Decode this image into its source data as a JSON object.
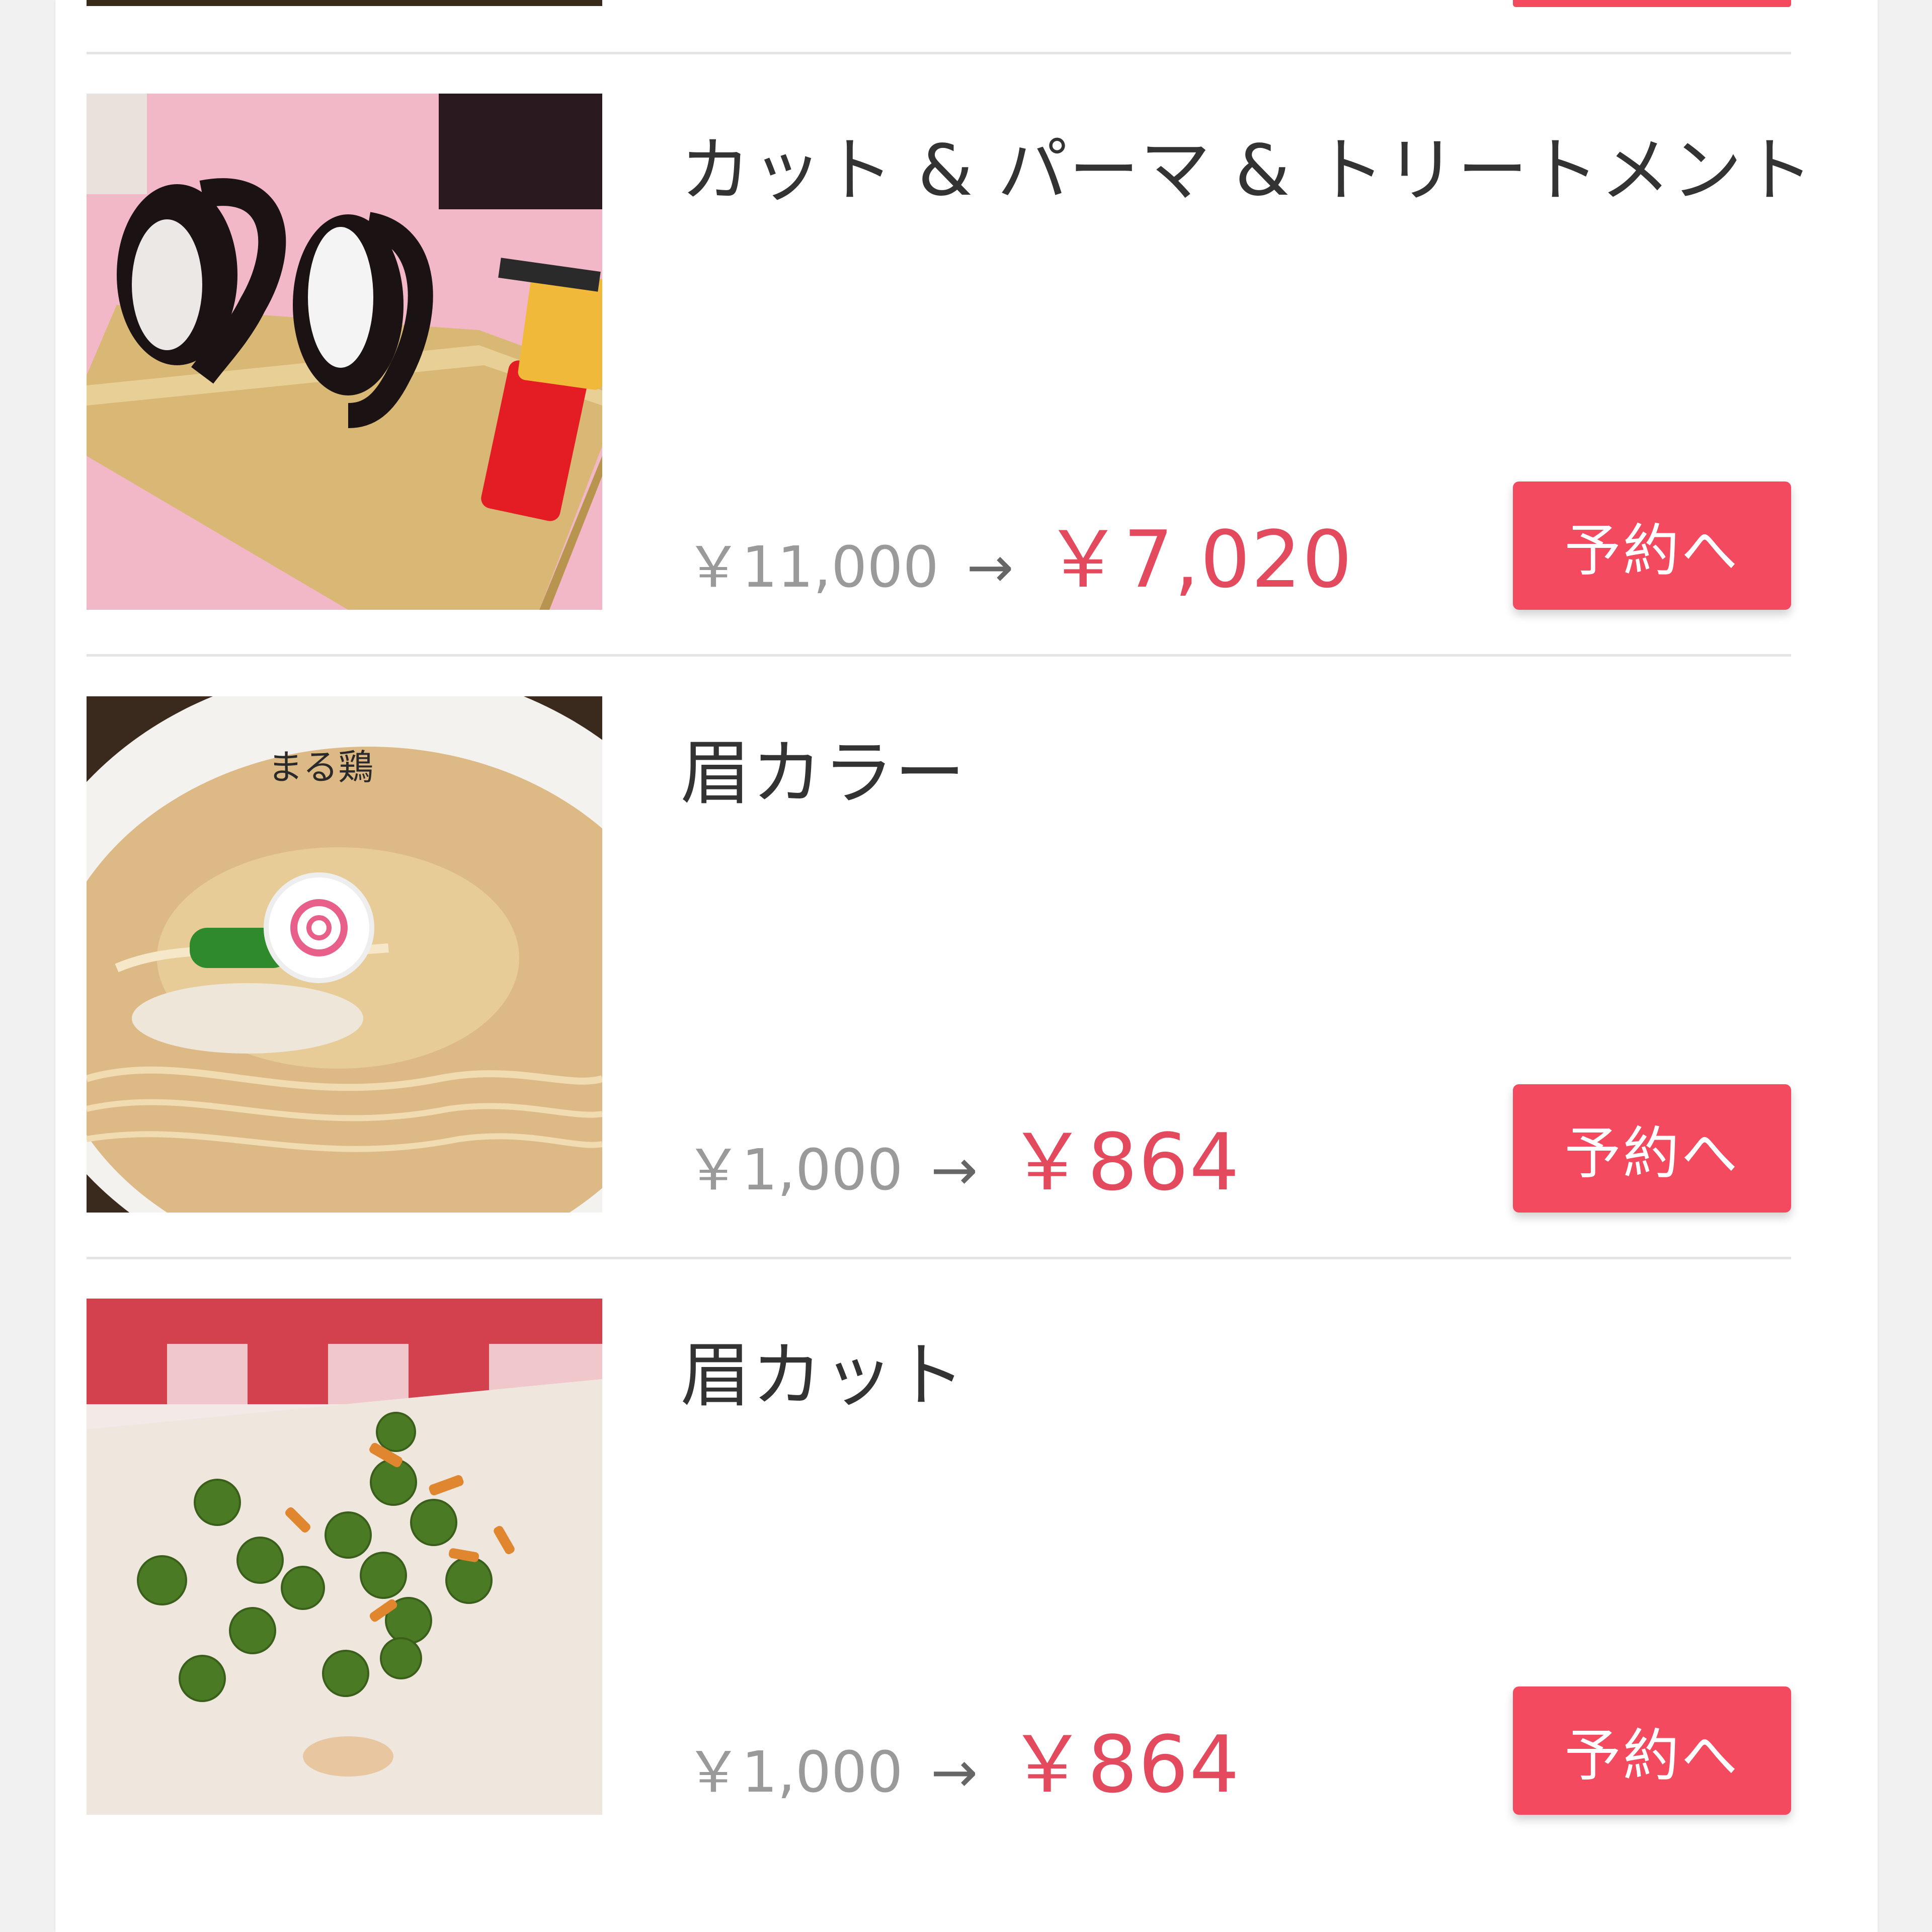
{
  "colors": {
    "accent": "#f44a60",
    "sale_price": "#e34a5e",
    "original_price": "#9a9a9a",
    "title_text": "#333333",
    "divider": "#e4e4e4"
  },
  "menu_items": [
    {
      "title": "カット & パーマ & トリートメント",
      "original_price": "￥11,000",
      "arrow": "→",
      "sale_price": "￥7,020",
      "button_label": "予約へ",
      "image": "wig-sushi-photo"
    },
    {
      "title": "眉カラー",
      "original_price": "￥1,000",
      "arrow": "→",
      "sale_price": "￥864",
      "button_label": "予約へ",
      "image": "ramen-bowl-photo"
    },
    {
      "title": "眉カット",
      "original_price": "￥1,000",
      "arrow": "→",
      "sale_price": "￥864",
      "button_label": "予約へ",
      "image": "green-peas-photo"
    }
  ]
}
